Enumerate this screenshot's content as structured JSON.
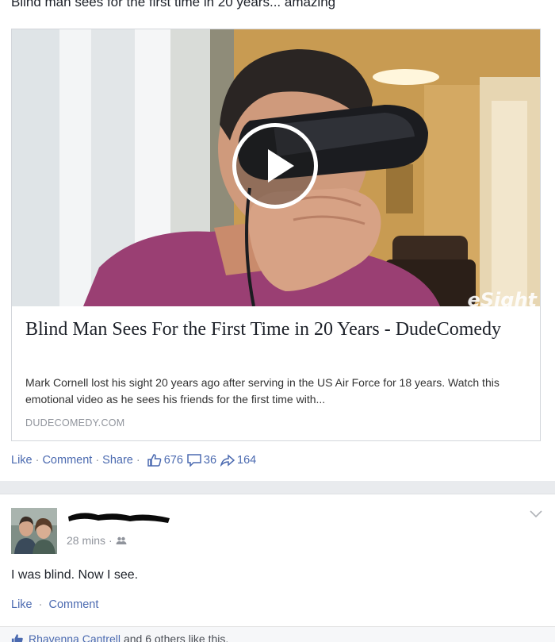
{
  "post1": {
    "text": "Blind man sees for the first time in 20 years... amazing",
    "link": {
      "watermark": "eSight",
      "title": "Blind Man Sees For the First Time in 20 Years - DudeComedy",
      "description": "Mark Cornell lost his sight 20 years ago after serving in the US Air Force for 18 years. Watch this emotional video as he sees his friends for the first time with...",
      "domain": "DUDECOMEDY.COM"
    },
    "actions": {
      "like": "Like",
      "comment": "Comment",
      "share": "Share",
      "separator": "·",
      "like_count": "676",
      "comment_count": "36",
      "share_count": "164"
    }
  },
  "post2": {
    "time": "28 mins",
    "separator": "·",
    "text": "I was blind. Now I see.",
    "actions": {
      "like": "Like",
      "comment": "Comment"
    },
    "likes": {
      "names": "Rhavenna Cantrell",
      "rest": "and 6 others like this."
    }
  },
  "icons": {
    "play": "play-icon",
    "thumbs_up": "thumbs-up-icon",
    "comment": "comment-icon",
    "share": "share-icon",
    "friends": "friends-audience-icon",
    "chevron": "chevron-down-icon"
  },
  "colors": {
    "link": "#4b6ab0",
    "text": "#1d2129",
    "muted": "#90949c",
    "background": "#e9ebee"
  }
}
